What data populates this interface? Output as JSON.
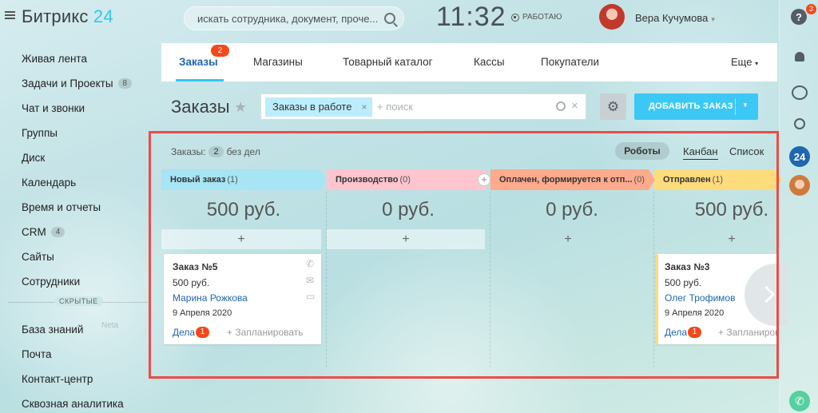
{
  "header": {
    "logo_text": "Битрикс",
    "logo_num": "24",
    "search_placeholder": "искать сотрудника, документ, проче...",
    "clock": "11:32",
    "work_status": "РАБОТАЮ",
    "user_name": "Вера Кучумова"
  },
  "sidebar": {
    "items": [
      {
        "label": "Живая лента",
        "count": ""
      },
      {
        "label": "Задачи и Проекты",
        "count": "8"
      },
      {
        "label": "Чат и звонки",
        "count": ""
      },
      {
        "label": "Группы",
        "count": ""
      },
      {
        "label": "Диск",
        "count": ""
      },
      {
        "label": "Календарь",
        "count": ""
      },
      {
        "label": "Время и отчеты",
        "count": ""
      },
      {
        "label": "CRM",
        "count": "4"
      },
      {
        "label": "Сайты",
        "count": ""
      },
      {
        "label": "Сотрудники",
        "count": ""
      }
    ],
    "hidden_label": "СКРЫТЫЕ",
    "hidden_items": [
      {
        "label": "База знаний"
      },
      {
        "label": "Почта"
      },
      {
        "label": "Контакт-центр"
      },
      {
        "label": "Сквозная аналитика"
      }
    ],
    "faded_text": "Neta"
  },
  "right_rail": {
    "help_badge": "3",
    "b24_label": "24"
  },
  "tabs": {
    "items": [
      {
        "label": "Заказы",
        "badge": "2"
      },
      {
        "label": "Магазины"
      },
      {
        "label": "Товарный каталог"
      },
      {
        "label": "Кассы"
      },
      {
        "label": "Покупатели"
      }
    ],
    "more": "Еще"
  },
  "page": {
    "title": "Заказы",
    "filter_chip": "Заказы в работе",
    "filter_placeholder": "+ поиск",
    "add_button": "ДОБАВИТЬ ЗАКАЗ"
  },
  "kanban": {
    "header_label": "Заказы:",
    "header_count": "2",
    "header_suffix": "без дел",
    "robots": "Роботы",
    "view_kanban": "Канбан",
    "view_list": "Список",
    "columns": [
      {
        "title": "Новый заказ",
        "count": "(1)",
        "sum": "500 руб.",
        "color": "#a7e4f4"
      },
      {
        "title": "Производство",
        "count": "(0)",
        "sum": "0 руб.",
        "color": "#fec5cf"
      },
      {
        "title": "Оплачен, формируется к отп...",
        "count": "(0)",
        "sum": "0 руб.",
        "color": "#fdab8c"
      },
      {
        "title": "Отправлен",
        "count": "(1)",
        "sum": "500 руб.",
        "color": "#fedb7d"
      }
    ],
    "add_symbol": "+",
    "cards": [
      {
        "title": "Заказ №5",
        "price": "500 руб.",
        "name": "Марина Рожкова",
        "date": "9 Апреля 2020",
        "tasks": "Дела",
        "tasks_count": "1",
        "plan": "+ Запланировать"
      },
      {
        "title": "Заказ №3",
        "price": "500 руб.",
        "name": "Олег Трофимов",
        "date": "9 Апреля 2020",
        "tasks": "Дела",
        "tasks_count": "1",
        "plan": "+ Запланировать"
      }
    ]
  }
}
